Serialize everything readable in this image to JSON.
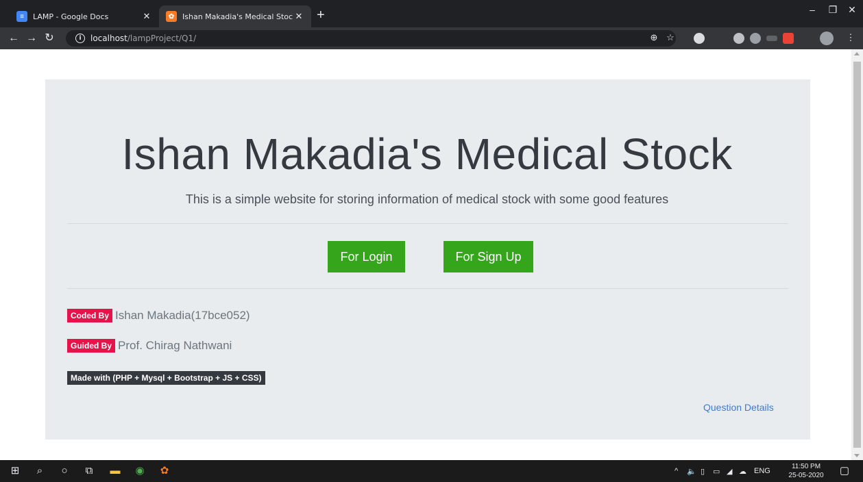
{
  "browser": {
    "tabs": [
      {
        "title": "LAMP - Google Docs",
        "favicon": "docs-icon",
        "active": false
      },
      {
        "title": "Ishan Makadia's Medical Stock",
        "favicon": "xampp-icon",
        "active": true
      }
    ],
    "address": {
      "host": "localhost",
      "path": "/lampProject/Q1/"
    }
  },
  "page": {
    "title": "Ishan Makadia's Medical Stock",
    "subtitle": "This is a simple website for storing information of medical stock with some good features",
    "buttons": {
      "login": "For Login",
      "signup": "For Sign Up"
    },
    "coded_by": {
      "badge": "Coded By",
      "value": "Ishan Makadia(17bce052)"
    },
    "guided_by": {
      "badge": "Guided By",
      "value": "Prof. Chirag Nathwani"
    },
    "made_with": "Made with (PHP + Mysql + Bootstrap + JS + CSS)",
    "question_link": "Question Details"
  },
  "taskbar": {
    "language": "ENG",
    "time": "11:50 PM",
    "date": "25-05-2020"
  },
  "colors": {
    "jumbotron_bg": "#e9ecef",
    "button_green": "#35a51c",
    "badge_red": "#e6124a",
    "badge_dark": "#343a40",
    "link_blue": "#3a7bd5"
  }
}
